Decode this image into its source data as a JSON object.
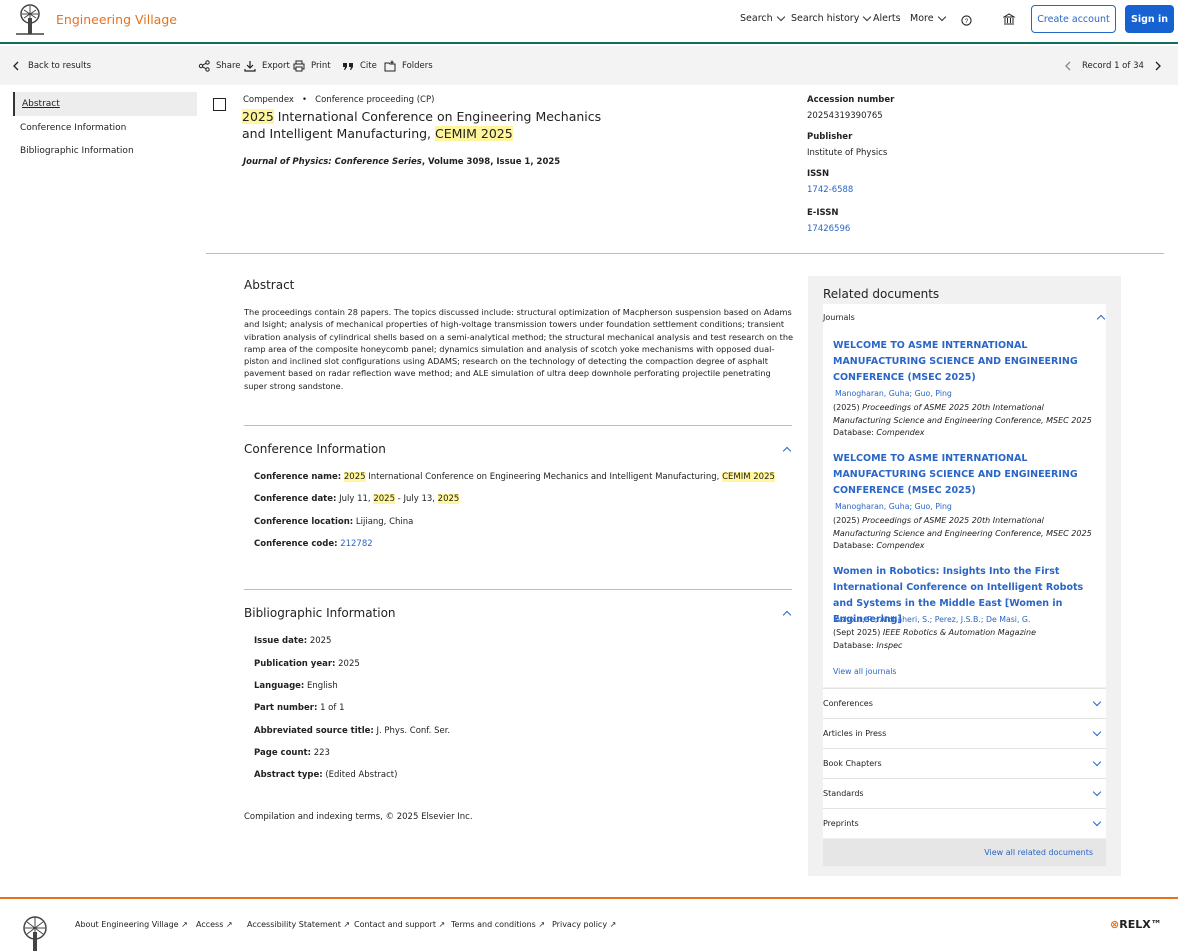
{
  "brand": {
    "name": "Engineering Village"
  },
  "nav": {
    "search": "Search",
    "search_history": "Search history",
    "alerts": "Alerts",
    "more": "More",
    "create_account": "Create account",
    "sign_in": "Sign in"
  },
  "toolbar": {
    "back": "Back to results",
    "share": "Share",
    "export": "Export",
    "print": "Print",
    "cite": "Cite",
    "folders": "Folders",
    "record": "Record 1 of 34"
  },
  "sidebar": {
    "items": [
      "Abstract",
      "Conference Information",
      "Bibliographic Information"
    ]
  },
  "record": {
    "database": "Compendex",
    "doctype": "Conference proceeding (CP)",
    "title_parts": [
      "2025",
      " International Conference on Engineering Mechanics and Intelligent Manufacturing, ",
      "CEMIM",
      " ",
      "2025"
    ],
    "journal_name": "Journal of Physics: Conference Series",
    "journal_rest": ", Volume 3098, Issue 1, 2025"
  },
  "meta": {
    "accession_label": "Accession number",
    "accession": "20254319390765",
    "publisher_label": "Publisher",
    "publisher": "Institute of Physics",
    "issn_label": "ISSN",
    "issn": "1742-6588",
    "eissn_label": "E-ISSN",
    "eissn": "17426596"
  },
  "abstract": {
    "heading": "Abstract",
    "text": "The proceedings contain 28 papers. The topics discussed include: structural optimization of Macpherson suspension based on Adams and Isight; analysis of mechanical properties of high-voltage transmission towers under foundation settlement conditions; transient vibration analysis of cylindrical shells based on a semi-analytical method; the structural mechanical analysis and test research on the ramp area of the composite honeycomb panel; dynamics simulation and analysis of scotch yoke mechanisms with opposed dual-piston and inclined slot configurations using ADAMS; research on the technology of detecting the compaction degree of asphalt pavement based on radar reflection wave method; and ALE simulation of ultra deep downhole perforating projectile penetrating super strong sandstone."
  },
  "conference": {
    "heading": "Conference Information",
    "name_label": "Conference name:",
    "name_parts": [
      "2025",
      " International Conference on Engineering Mechanics and Intelligent Manufacturing, ",
      "CEMIM",
      " ",
      "2025"
    ],
    "date_label": "Conference date:",
    "date_parts": [
      "July 11, ",
      "2025",
      " - July 13, ",
      "2025"
    ],
    "location_label": "Conference location:",
    "location": "Lijiang, China",
    "code_label": "Conference code:",
    "code": "212782"
  },
  "biblio": {
    "heading": "Bibliographic Information",
    "fields": [
      {
        "label": "Issue date:",
        "value": "2025"
      },
      {
        "label": "Publication year:",
        "value": "2025"
      },
      {
        "label": "Language:",
        "value": "English"
      },
      {
        "label": "Part number:",
        "value": "1 of 1"
      },
      {
        "label": "Abbreviated source title:",
        "value": "J. Phys. Conf. Ser."
      },
      {
        "label": "Page count:",
        "value": "223"
      },
      {
        "label": "Abstract type:",
        "value": "(Edited Abstract)"
      }
    ],
    "copyright": "Compilation and indexing terms, © 2025 Elsevier Inc."
  },
  "related": {
    "heading": "Related documents",
    "journals_label": "Journals",
    "items": [
      {
        "title": "WELCOME TO ASME INTERNATIONAL MANUFACTURING SCIENCE AND ENGINEERING CONFERENCE (MSEC 2025)",
        "authors": "Manogharan, Guha;  Guo, Ping",
        "year": "(2025) ",
        "source": "Proceedings of ASME 2025 20th International Manufacturing Science and Engineering Conference, MSEC 2025",
        "db_label": "Database: ",
        "db": "Compendex"
      },
      {
        "title": "WELCOME TO ASME INTERNATIONAL MANUFACTURING SCIENCE AND ENGINEERING CONFERENCE (MSEC 2025)",
        "authors": "Manogharan, Guha;  Guo, Ping",
        "year": "(2025) ",
        "source": "Proceedings of ASME 2025 20th International Manufacturing Science and Engineering Conference, MSEC 2025",
        "db_label": "Database: ",
        "db": "Compendex"
      },
      {
        "title": "Women in Robotics: Insights Into the First International Conference on Intelligent Robots and Systems in the Middle East [Women in Engineering]",
        "authors": "Ashour, R.;  Aldhaheri, S.;  Perez, J.S.B.;  De Masi, G.",
        "year": "(Sept 2025) ",
        "source": "IEEE Robotics & Automation Magazine",
        "db_label": "Database: ",
        "db": "Inspec"
      }
    ],
    "view_all_journals": "View all journals",
    "sections": [
      "Conferences",
      "Articles in Press",
      "Book Chapters",
      "Standards",
      "Preprints"
    ],
    "view_all_related": "View all related documents"
  },
  "footer": {
    "links": [
      "About Engineering Village",
      "Access",
      "Accessibility Statement",
      "Contact and support",
      "Terms and conditions",
      "Privacy policy"
    ],
    "relx": "RELX™"
  },
  "colors": {
    "brand_orange": "#e9711c",
    "link_blue": "#2a66c7",
    "highlight": "#fff59a",
    "header_rule": "#0f6e5c"
  }
}
